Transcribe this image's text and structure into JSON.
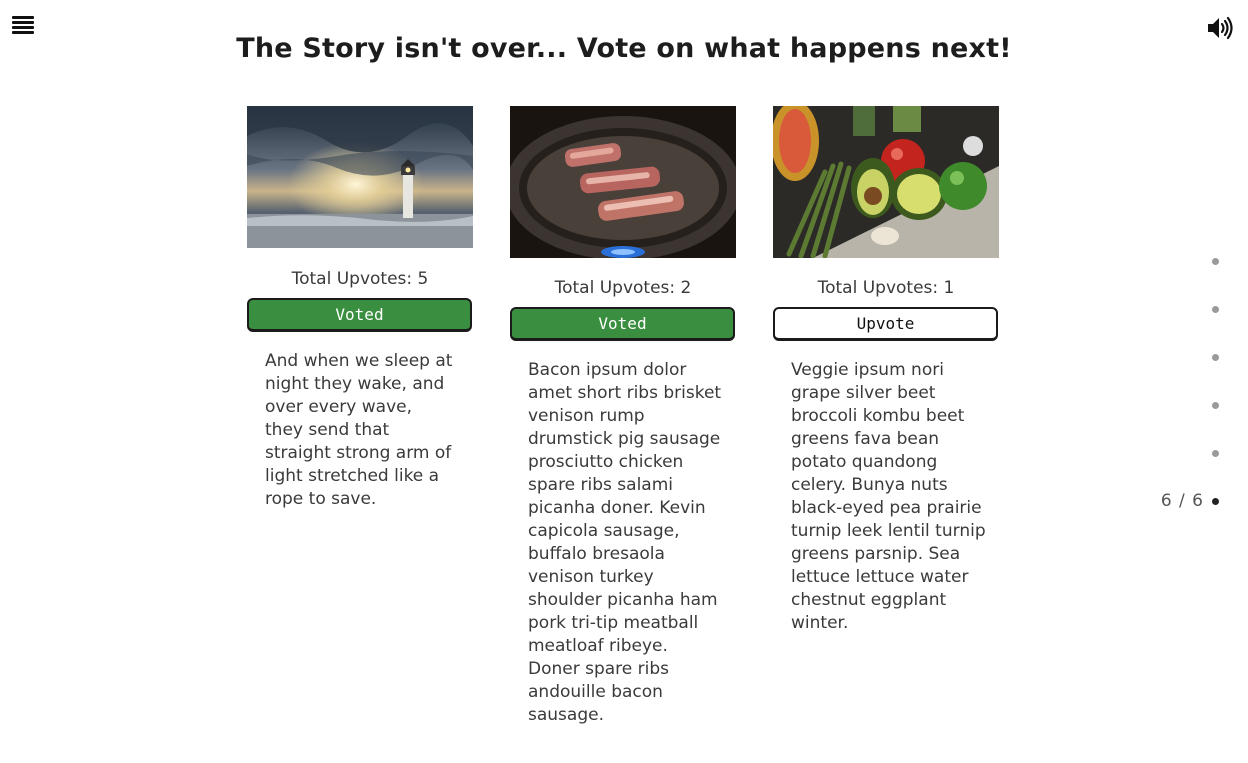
{
  "header": {
    "menu_icon": "hamburger-menu-icon",
    "sound_icon": "speaker-volume-icon",
    "title": "The Story isn't over... Vote on what happens next!"
  },
  "cards": [
    {
      "image": "lighthouse-at-sunset-photo",
      "upvotes_label": "Total Upvotes: 5",
      "button_label": "Voted",
      "button_state": "voted",
      "text": "And when we sleep at night they wake, and over every wave, they send that straight strong arm of light stretched like a rope to save."
    },
    {
      "image": "meat-grilling-on-pan-photo",
      "upvotes_label": "Total Upvotes: 2",
      "button_label": "Voted",
      "button_state": "voted",
      "text": "Bacon ipsum dolor amet short ribs brisket venison rump drumstick pig sausage prosciutto chicken spare ribs salami picanha doner. Kevin capicola sausage, buffalo bresaola venison turkey shoulder picanha ham pork tri-tip meatball meatloaf ribeye. Doner spare ribs andouille bacon sausage."
    },
    {
      "image": "fresh-vegetables-photo",
      "upvotes_label": "Total Upvotes: 1",
      "button_label": "Upvote",
      "button_state": "upvote",
      "text": "Veggie ipsum nori grape silver beet broccoli kombu beet greens fava bean potato quandong celery. Bunya nuts black-eyed pea prairie turnip leek lentil turnip greens parsnip. Sea lettuce lettuce water chestnut eggplant winter."
    }
  ],
  "pagination": {
    "label": "6 / 6",
    "total": 6,
    "current": 6
  },
  "colors": {
    "voted_green": "#3a8e3f",
    "text": "#3a3a3a"
  }
}
